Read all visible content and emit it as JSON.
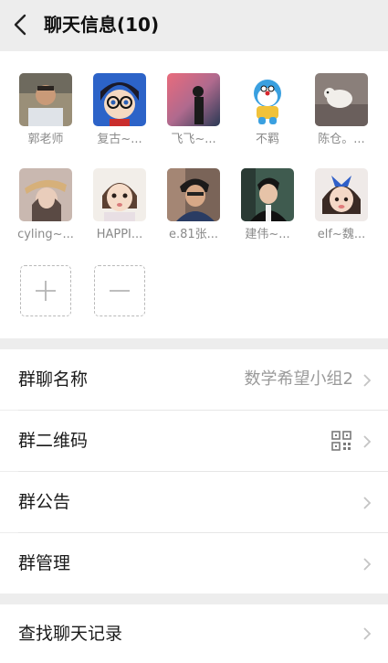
{
  "header": {
    "title": "聊天信息(10)"
  },
  "members": [
    {
      "name": "郭老师"
    },
    {
      "name": "复古~..."
    },
    {
      "name": "飞飞~..."
    },
    {
      "name": "不羁"
    },
    {
      "name": "陈仓。..."
    },
    {
      "name": "cyling~..."
    },
    {
      "name": "HAPPI..."
    },
    {
      "name": "e.81张..."
    },
    {
      "name": "建伟~..."
    },
    {
      "name": "elf~魏..."
    }
  ],
  "settings": {
    "group_name_label": "群聊名称",
    "group_name_value": "数学希望小组2",
    "qrcode_label": "群二维码",
    "announcement_label": "群公告",
    "manage_label": "群管理",
    "search_history_label": "查找聊天记录"
  },
  "icons": {
    "back": "back-arrow-icon",
    "add": "plus-icon",
    "remove": "minus-icon",
    "chevron": "chevron-right-icon",
    "qr": "qrcode-icon"
  }
}
